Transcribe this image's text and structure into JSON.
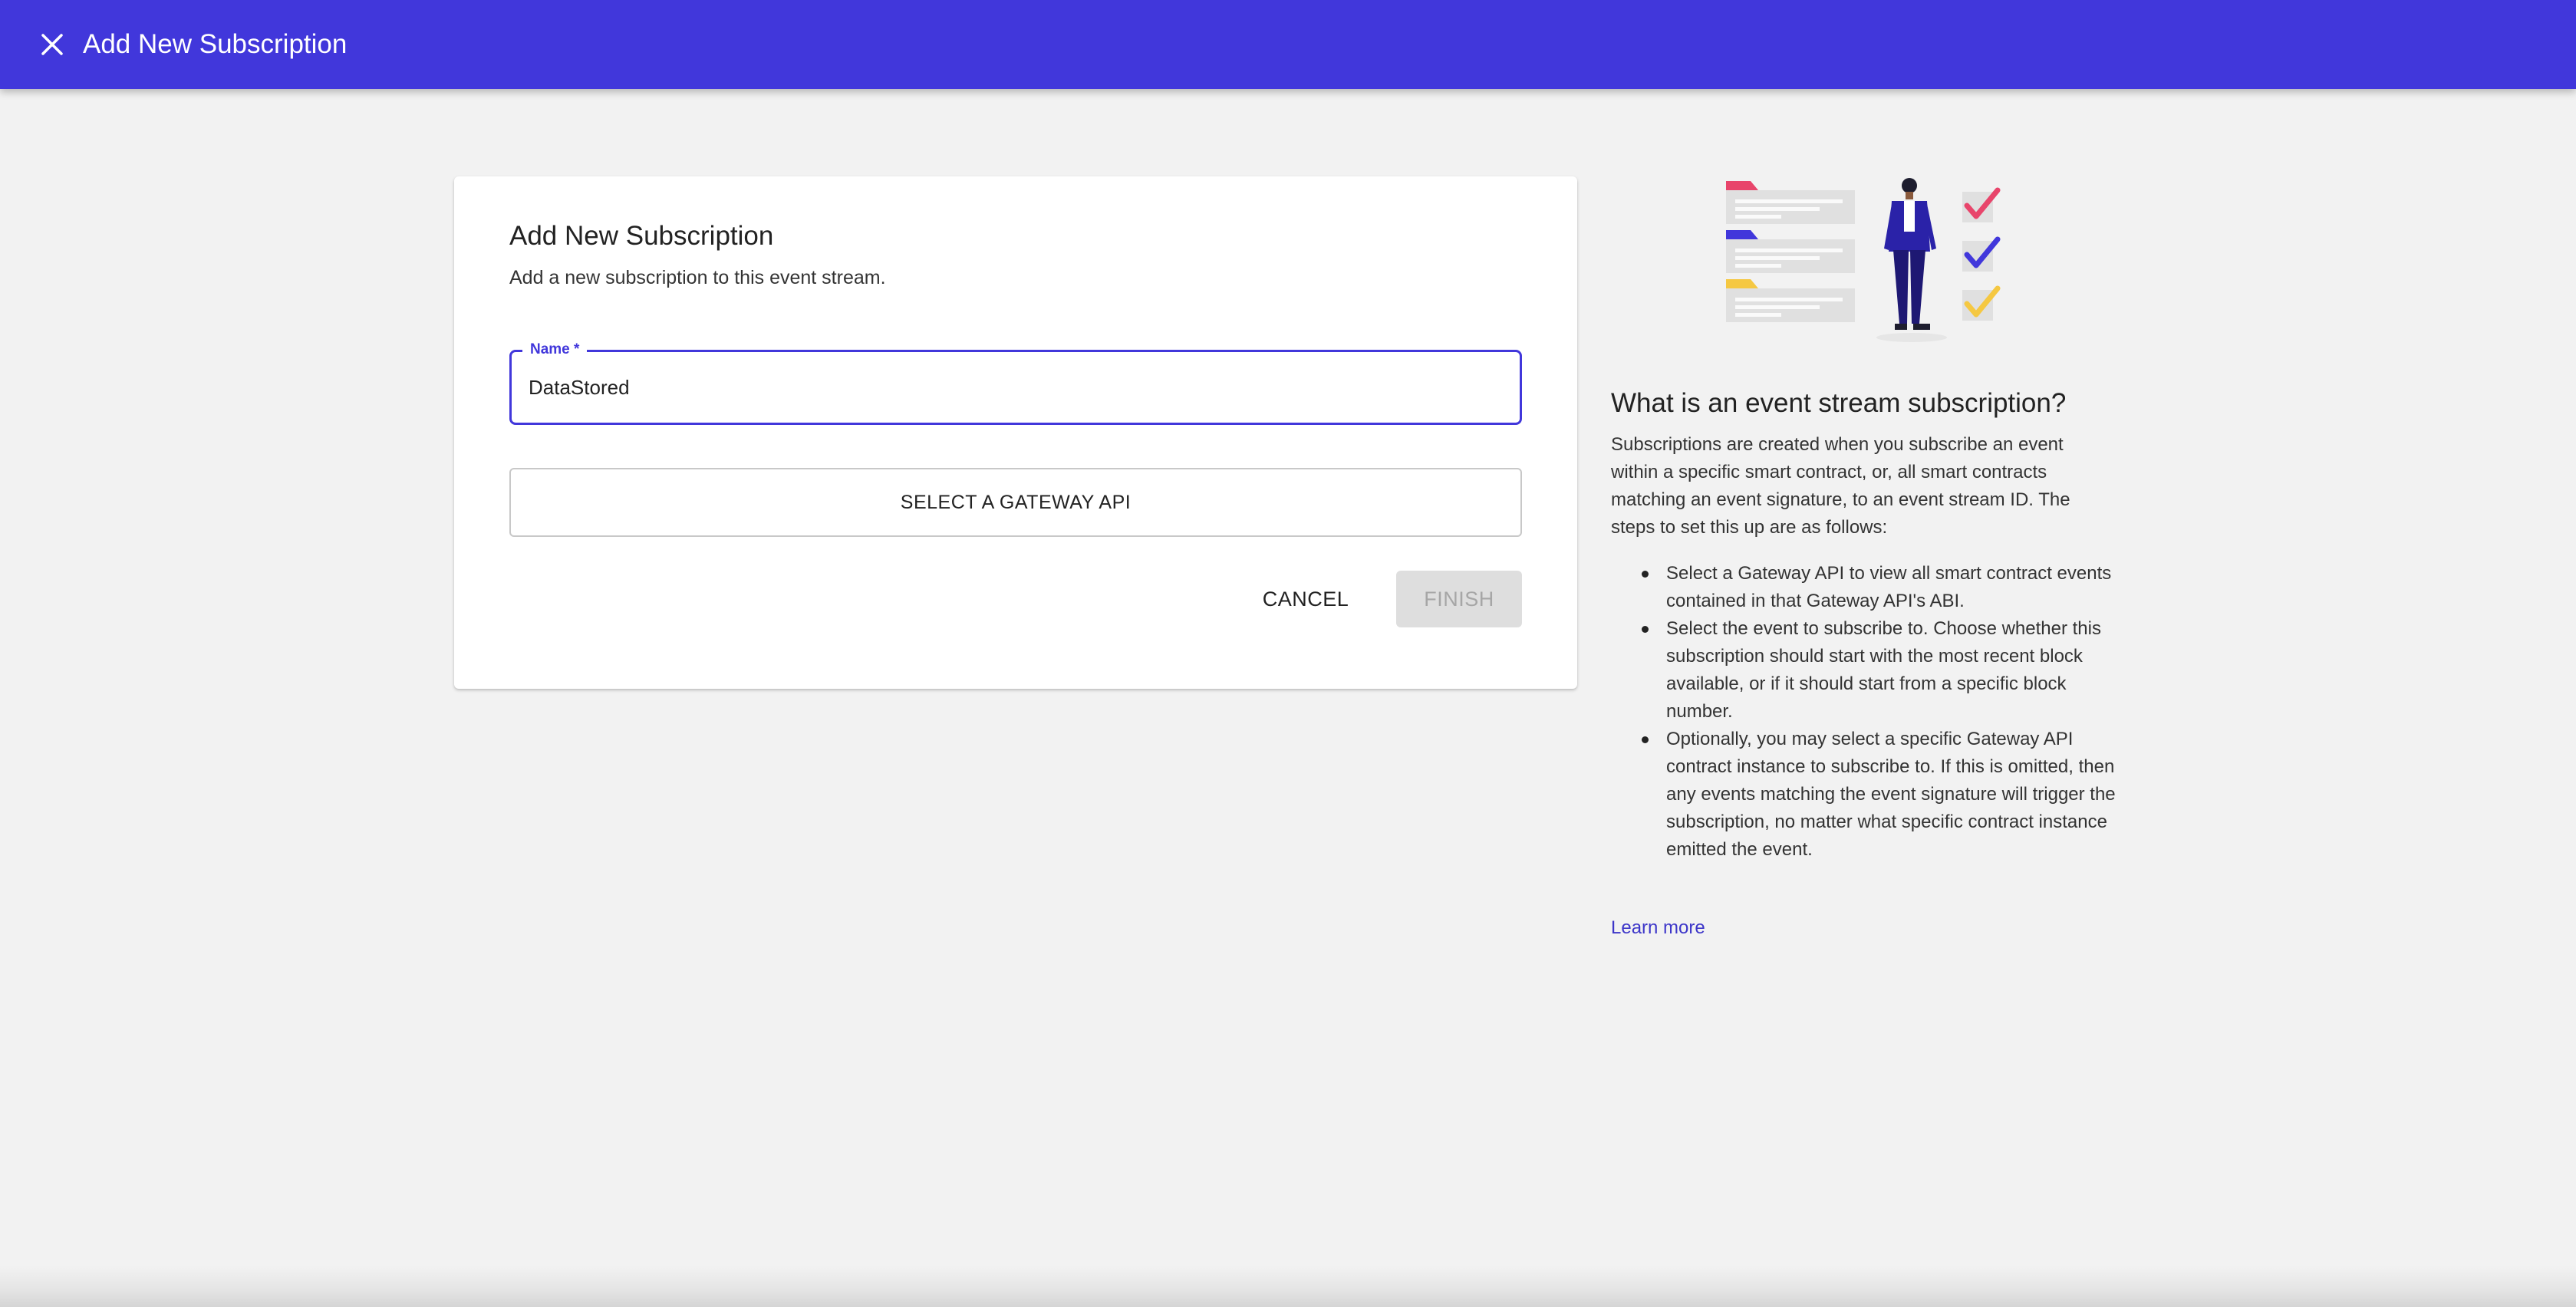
{
  "appbar": {
    "title": "Add New Subscription",
    "close_icon": "close-icon",
    "color": "#4137db"
  },
  "card": {
    "title": "Add New Subscription",
    "subtitle": "Add a new subscription to this event stream.",
    "name_field": {
      "label": "Name *",
      "value": "DataStored",
      "placeholder": ""
    },
    "gateway_button_label": "SELECT A GATEWAY API",
    "cancel_label": "CANCEL",
    "finish_label": "FINISH",
    "finish_disabled": true
  },
  "info": {
    "illustration_icon": "checklist-person-illustration",
    "title": "What is an event stream subscription?",
    "intro": "Subscriptions are created when you subscribe an event within a specific smart contract, or, all smart contracts matching an event signature, to an event stream ID. The steps to set this up are as follows:",
    "steps": [
      "Select a Gateway API to view all smart contract events contained in that Gateway API's ABI.",
      "Select the event to subscribe to. Choose whether this subscription should start with the most recent block available, or if it should start from a specific block number.",
      "Optionally, you may select a specific Gateway API contract instance to subscribe to. If this is omitted, then any events matching the event signature will trigger the subscription, no matter what specific contract instance emitted the event."
    ],
    "learn_more_label": "Learn more",
    "link_color": "#3d36c9"
  }
}
